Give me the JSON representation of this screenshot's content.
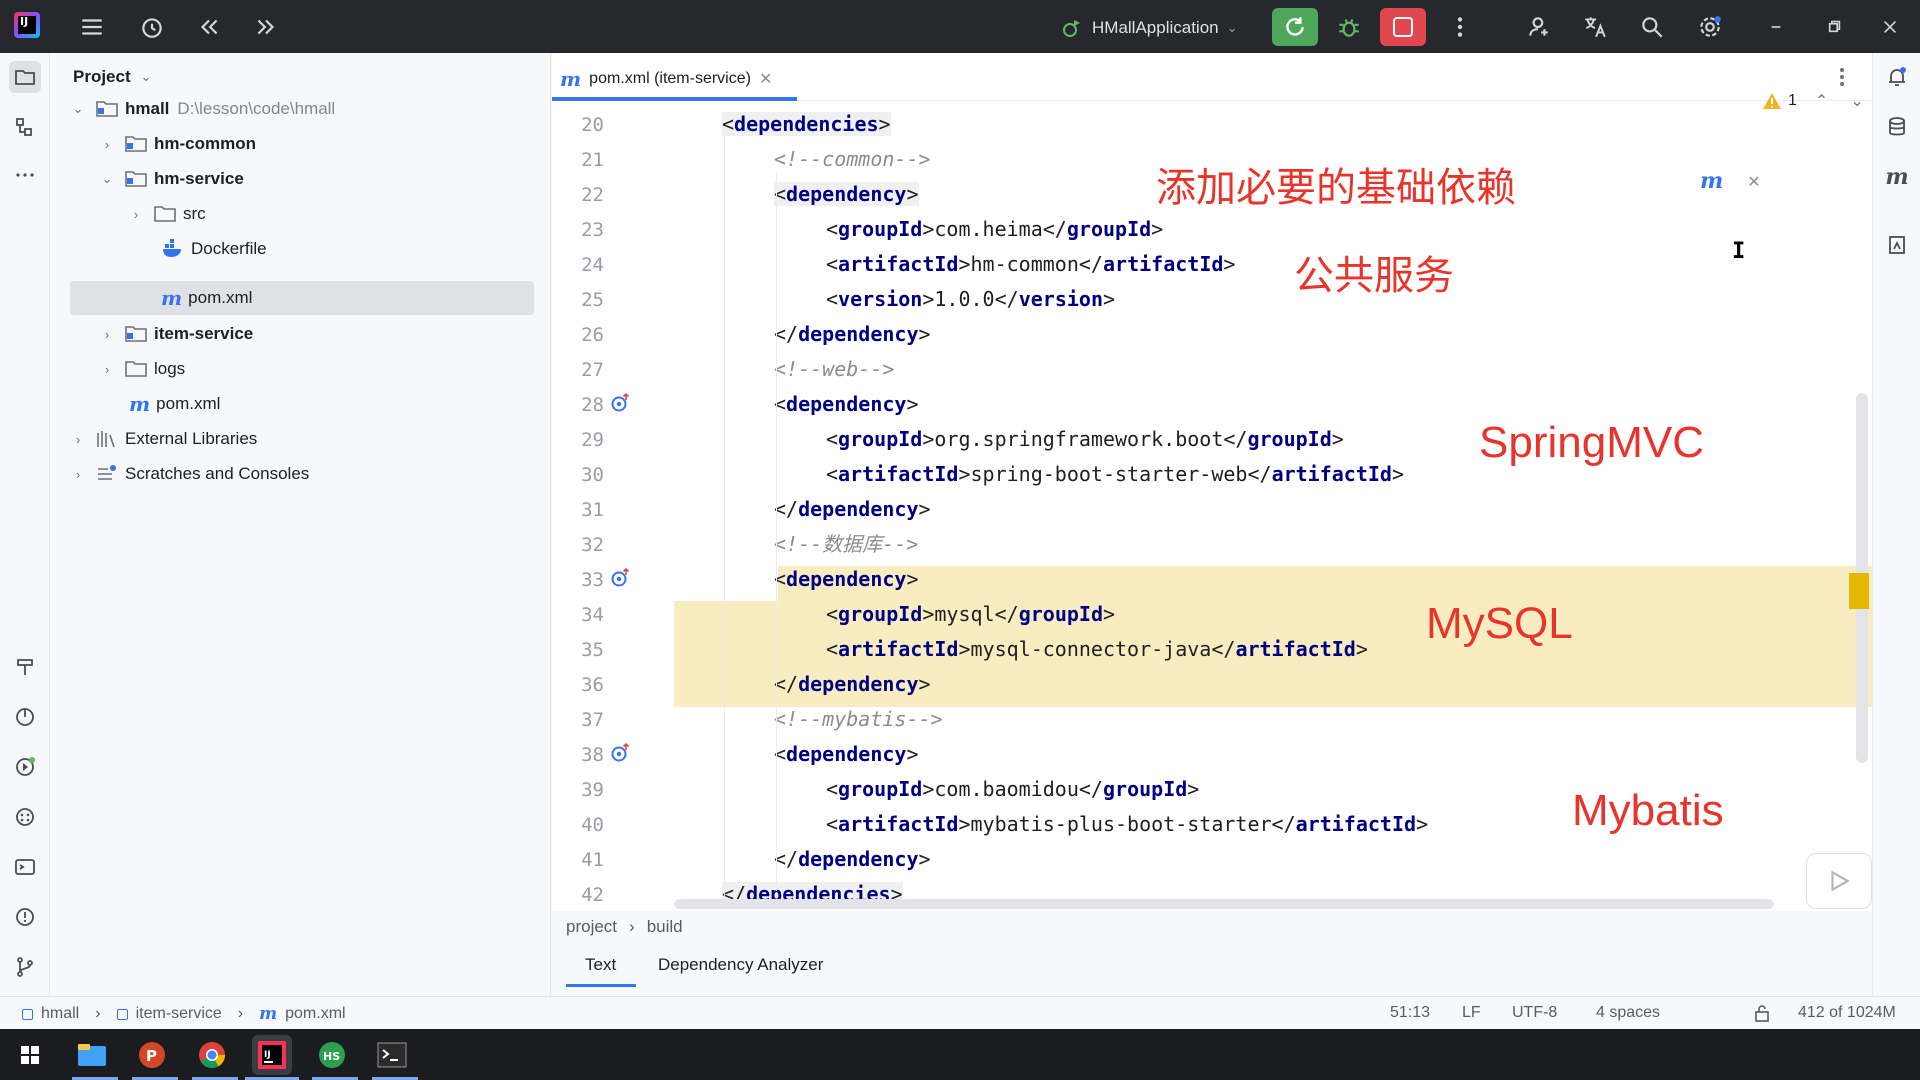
{
  "titlebar": {
    "run_config": "HMallApplication"
  },
  "project_panel": {
    "header": "Project",
    "tree": [
      {
        "label": "hmall",
        "path": "D:\\lesson\\code\\hmall",
        "bold": true
      },
      {
        "label": "hm-common",
        "bold": true
      },
      {
        "label": "hm-service",
        "bold": true
      },
      {
        "label": "src"
      },
      {
        "label": "Dockerfile"
      },
      {
        "label": "pom.xml"
      },
      {
        "label": "item-service",
        "bold": true
      },
      {
        "label": "logs"
      },
      {
        "label": "pom.xml"
      },
      {
        "label": "External Libraries"
      },
      {
        "label": "Scratches and Consoles"
      }
    ]
  },
  "editor": {
    "tab_label": "pom.xml (item-service)",
    "warning_count": "1",
    "lines": [
      {
        "n": "20"
      },
      {
        "n": "21"
      },
      {
        "n": "22"
      },
      {
        "n": "23"
      },
      {
        "n": "24"
      },
      {
        "n": "25"
      },
      {
        "n": "26"
      },
      {
        "n": "27"
      },
      {
        "n": "28"
      },
      {
        "n": "29"
      },
      {
        "n": "30"
      },
      {
        "n": "31"
      },
      {
        "n": "32"
      },
      {
        "n": "33"
      },
      {
        "n": "34"
      },
      {
        "n": "35"
      },
      {
        "n": "36"
      },
      {
        "n": "37"
      },
      {
        "n": "38"
      },
      {
        "n": "39"
      },
      {
        "n": "40"
      },
      {
        "n": "41"
      },
      {
        "n": "42"
      }
    ],
    "code": {
      "dependencies_open": "dependencies",
      "comment_common": "<!--common-->",
      "dependency": "dependency",
      "groupId": "groupId",
      "artifactId": "artifactId",
      "version": "version",
      "g1": "com.heima",
      "a1": "hm-common",
      "v1": "1.0.0",
      "comment_web": "<!--web-->",
      "g2": "org.springframework.boot",
      "a2": "spring-boot-starter-web",
      "comment_db": "<!--数据库-->",
      "g3": "mysql",
      "a3": "mysql-connector-java",
      "comment_mybatis": "<!--mybatis-->",
      "g4": "com.baomidou",
      "a4": "mybatis-plus-boot-starter"
    },
    "annotations": {
      "a1": "添加必要的基础依赖",
      "a2": "公共服务",
      "a3": "SpringMVC",
      "a4": "MySQL",
      "a5": "Mybatis"
    }
  },
  "editor_footer": {
    "crumb1": "project",
    "crumb2": "build",
    "tab_text": "Text",
    "tab_dep": "Dependency Analyzer"
  },
  "statusbar": {
    "crumb1": "hmall",
    "crumb2": "item-service",
    "crumb3": "pom.xml",
    "position": "51:13",
    "line_sep": "LF",
    "encoding": "UTF-8",
    "indent": "4 spaces",
    "memory": "412 of 1024M"
  },
  "colors": {
    "accent": "#3574f0",
    "run_green": "#4ea75b",
    "stop_red": "#e0474f",
    "annotation_red": "#e8342b",
    "highlight_yellow": "#f8edc0"
  }
}
